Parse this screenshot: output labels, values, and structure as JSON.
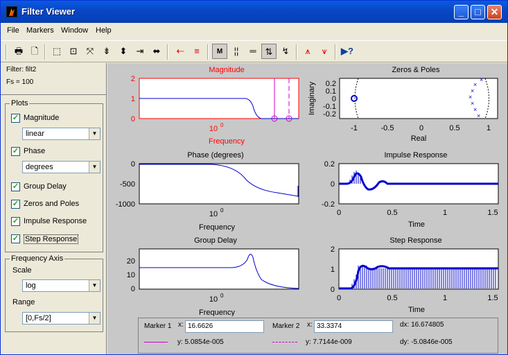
{
  "window": {
    "title": "Filter Viewer"
  },
  "menu": {
    "file": "File",
    "markers": "Markers",
    "window": "Window",
    "help": "Help"
  },
  "toolbar": {
    "icons": [
      "print-icon",
      "print-preview-icon",
      "zoom-box-icon",
      "zoom-x-icon",
      "zoom-in-icon",
      "zoom-in-y-icon",
      "zoom-out-y-icon",
      "zoom-in-x-icon",
      "zoom-out-x-icon",
      "marker-crosshair-icon",
      "marker-lines-icon",
      "marker-mode-icon",
      "vertical-markers-icon",
      "horizontal-markers-icon",
      "track-marker-icon",
      "peak-marker-icon",
      "valley-marker-icon",
      "whats-this-icon"
    ]
  },
  "info": {
    "filter": "Filter: filt2",
    "fs": "Fs = 100"
  },
  "plots_group": {
    "title": "Plots",
    "items": [
      {
        "label": "Magnitude",
        "checked": true
      },
      {
        "label": "Phase",
        "checked": true
      },
      {
        "label": "Group Delay",
        "checked": true
      },
      {
        "label": "Zeros and Poles",
        "checked": true
      },
      {
        "label": "Impulse Response",
        "checked": true
      },
      {
        "label": "Step Response",
        "checked": true
      }
    ],
    "magnitude_scale": "linear",
    "phase_units": "degrees"
  },
  "freq_group": {
    "title": "Frequency Axis",
    "scale_label": "Scale",
    "scale_value": "log",
    "range_label": "Range",
    "range_value": "[0,Fs/2]"
  },
  "plots": {
    "magnitude": {
      "title": "Magnitude",
      "xlabel": "Frequency",
      "xtick": "10",
      "xtick_exp": "0",
      "yticks": [
        "2",
        "1",
        "0"
      ],
      "color": "#ff0000"
    },
    "zeros_poles": {
      "title": "Zeros & Poles",
      "xlabel": "Real",
      "ylabel": "Imaginary",
      "yticks": [
        "0.2",
        "0.1",
        "0",
        "-0.1",
        "-0.2"
      ],
      "xticks": [
        "-1",
        "-0.5",
        "0",
        "0.5",
        "1"
      ]
    },
    "phase": {
      "title": "Phase (degrees)",
      "xlabel": "Frequency",
      "xtick": "10",
      "xtick_exp": "0",
      "yticks": [
        "0",
        "-500",
        "-1000"
      ]
    },
    "impulse": {
      "title": "Impulse Response",
      "xlabel": "Time",
      "yticks": [
        "0.2",
        "0",
        "-0.2"
      ],
      "xticks": [
        "0",
        "0.5",
        "1",
        "1.5"
      ]
    },
    "group_delay": {
      "title": "Group Delay",
      "xlabel": "Frequency",
      "xtick": "10",
      "xtick_exp": "0",
      "yticks": [
        "20",
        "10",
        "0"
      ]
    },
    "step": {
      "title": "Step Response",
      "xlabel": "Time",
      "yticks": [
        "2",
        "1",
        "0"
      ],
      "xticks": [
        "0",
        "0.5",
        "1",
        "1.5"
      ]
    }
  },
  "markers": {
    "m1_label": "Marker 1",
    "m1_x_label": "x:",
    "m1_x": "16.6626",
    "m1_y": "y: 5.0854e-005",
    "m2_label": "Marker 2",
    "m2_x_label": "x:",
    "m2_x": "33.3374",
    "m2_y": "y: 7.7144e-009",
    "dx": "dx: 16.674805",
    "dy": "dy: -5.0846e-005",
    "color": "#cc00cc"
  }
}
